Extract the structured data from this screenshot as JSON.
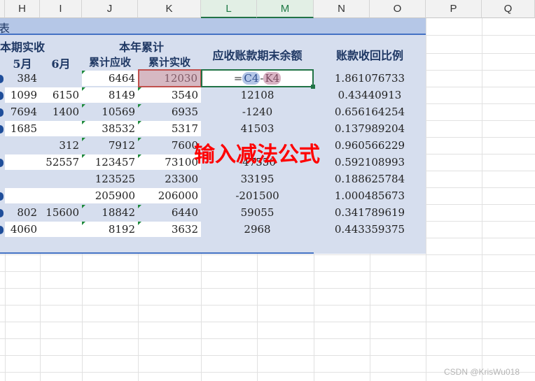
{
  "columns": [
    "H",
    "I",
    "J",
    "K",
    "L",
    "M",
    "N",
    "O",
    "P",
    "Q"
  ],
  "selected_columns": [
    "L",
    "M"
  ],
  "title_fragment": "表",
  "headers": {
    "period_actual": "本期实收",
    "may": "5月",
    "june": "6月",
    "ytd": "本年累计",
    "ytd_receivable": "累计应收",
    "ytd_received": "累计实收",
    "ending_balance": "应收账款期末余额",
    "recovery_ratio": "账款收回比例"
  },
  "rows": [
    {
      "may": "384",
      "june": "",
      "ytd_receivable": "6464",
      "ytd_received": "12030",
      "balance": "",
      "ratio": "1.861076733"
    },
    {
      "may": "1099",
      "june": "6150",
      "ytd_receivable": "8149",
      "ytd_received": "3540",
      "balance": "12108",
      "ratio": "0.43440913"
    },
    {
      "may": "7694",
      "june": "1400",
      "ytd_receivable": "10569",
      "ytd_received": "6935",
      "balance": "-1240",
      "ratio": "0.656164254"
    },
    {
      "may": "1685",
      "june": "",
      "ytd_receivable": "38532",
      "ytd_received": "5317",
      "balance": "41503",
      "ratio": "0.137989204"
    },
    {
      "may": "",
      "june": "312",
      "ytd_receivable": "7912",
      "ytd_received": "7600",
      "balance": "",
      "ratio": "0.960566229"
    },
    {
      "may": "",
      "june": "52557",
      "ytd_receivable": "123457",
      "ytd_received": "73100",
      "balance": "-47550",
      "ratio": "0.592108993"
    },
    {
      "may": "",
      "june": "",
      "ytd_receivable": "123525",
      "ytd_received": "23300",
      "balance": "33195",
      "ratio": "0.188625784"
    },
    {
      "may": "",
      "june": "",
      "ytd_receivable": "205900",
      "ytd_received": "206000",
      "balance": "-201500",
      "ratio": "1.000485673"
    },
    {
      "may": "802",
      "june": "15600",
      "ytd_receivable": "18842",
      "ytd_received": "6440",
      "balance": "59055",
      "ratio": "0.341789619"
    },
    {
      "may": "4060",
      "june": "",
      "ytd_receivable": "8192",
      "ytd_received": "3632",
      "balance": "2968",
      "ratio": "0.443359375"
    }
  ],
  "formula": {
    "eq": "=",
    "ref1": "C4",
    "op": "-",
    "ref2": "K4"
  },
  "callout": "输入减法公式",
  "watermark": "CSDN @KrisWu018",
  "colors": {
    "header_band": "#b5c7e7",
    "table_fill": "#d6deee",
    "border_blue": "#4472c4",
    "callout_red": "#ff0000",
    "selection_green": "#217346"
  }
}
